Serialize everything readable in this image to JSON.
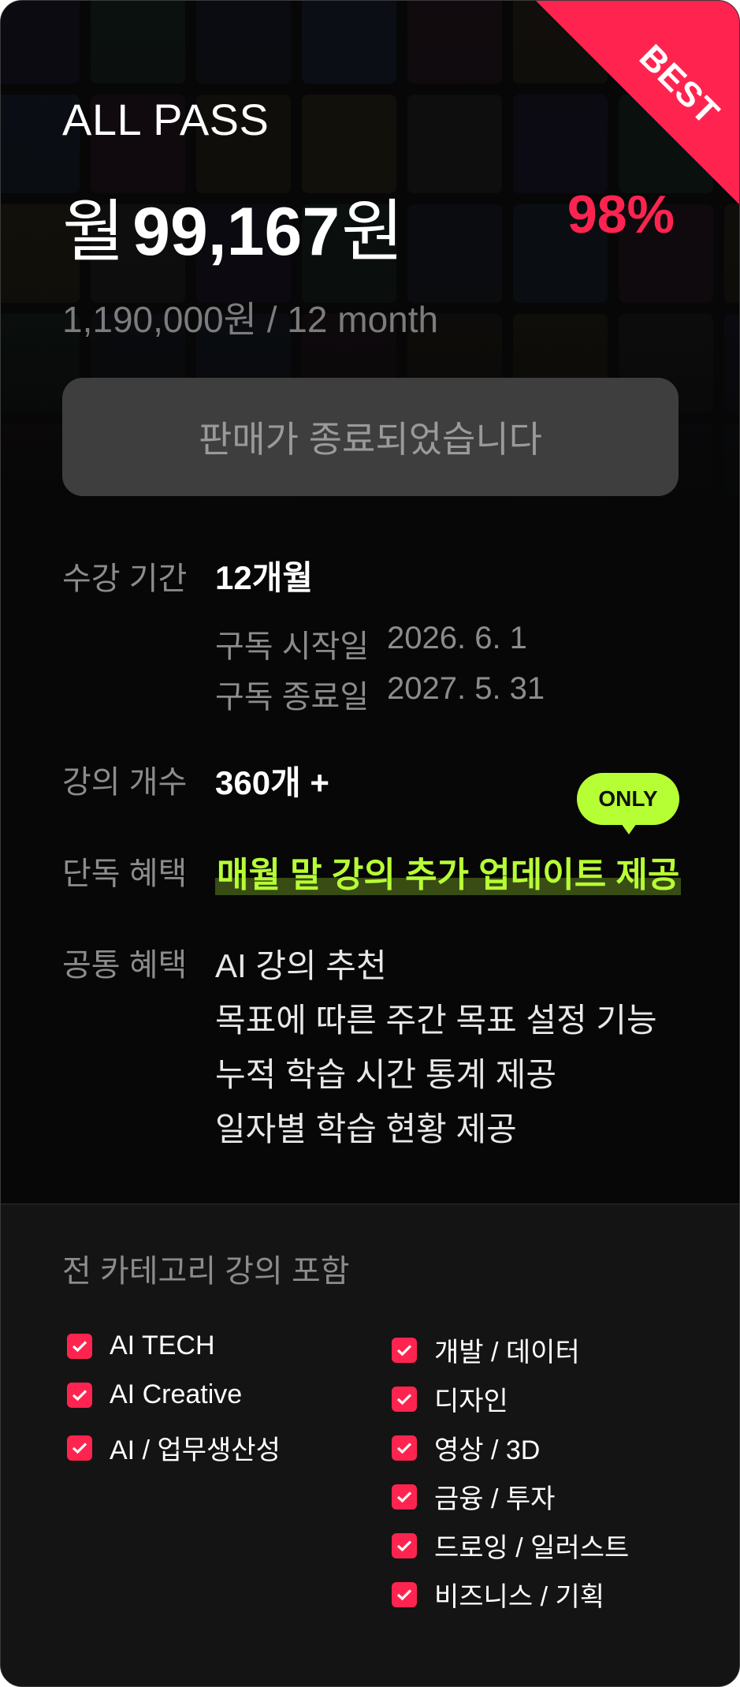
{
  "badge": {
    "best": "BEST",
    "only": "ONLY"
  },
  "plan": {
    "name": "ALL PASS",
    "price_prefix": "월",
    "price_amount": "99,167",
    "price_suffix": "원",
    "discount": "98%",
    "total_price": "1,190,000원 / 12 month",
    "sold_out_label": "판매가 종료되었습니다"
  },
  "details": {
    "period_label": "수강 기간",
    "period_value": "12개월",
    "start_label": "구독 시작일",
    "start_date": "2026. 6. 1",
    "end_label": "구독 종료일",
    "end_date": "2027. 5. 31",
    "count_label": "강의 개수",
    "count_value": "360개 +",
    "exclusive_label": "단독 혜택",
    "exclusive_value": "매월 말 강의 추가 업데이트 제공",
    "common_label": "공통 혜택",
    "common_items": [
      "AI 강의 추천",
      "목표에 따른 주간 목표 설정 기능",
      "누적 학습 시간 통계 제공",
      "일자별 학습 현황 제공"
    ]
  },
  "categories": {
    "title": "전 카테고리 강의 포함",
    "left": [
      "AI TECH",
      "AI Creative",
      "AI / 업무생산성"
    ],
    "right": [
      "개발 / 데이터",
      "디자인",
      "영상 / 3D",
      "금융 / 투자",
      "드로잉 / 일러스트",
      "비즈니스 / 기획"
    ]
  },
  "colors": {
    "accent": "#ff2450",
    "highlight": "#b7ff35",
    "background": "#070707"
  }
}
